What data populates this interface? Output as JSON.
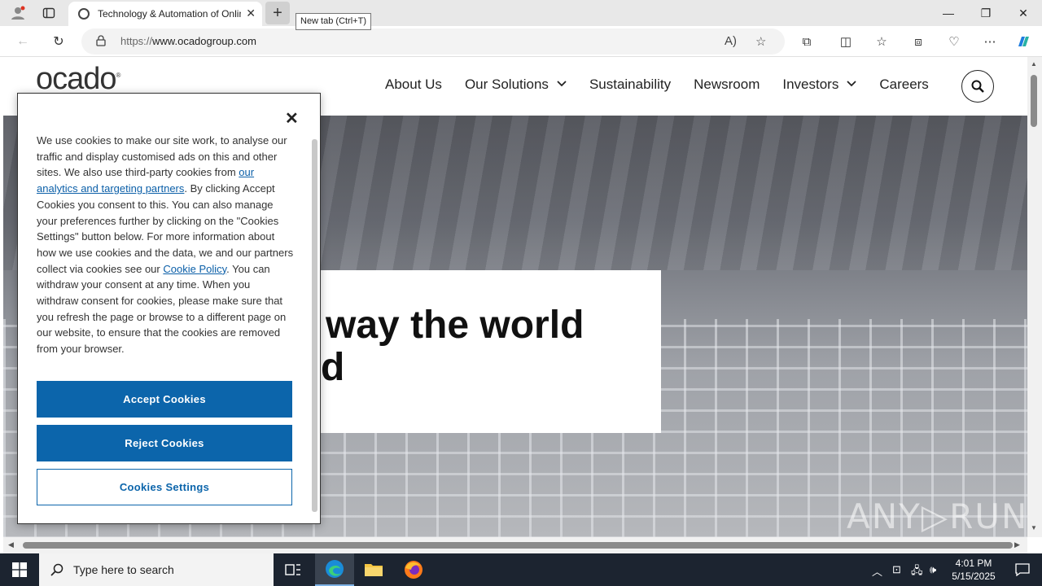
{
  "browser": {
    "tab_title": "Technology & Automation of Online Grocery Retail",
    "new_tab_tooltip": "New tab (Ctrl+T)",
    "url_prefix": "https://",
    "url_domain": "www.ocadogroup.com"
  },
  "site": {
    "logo": "ocado",
    "nav": {
      "about": "About Us",
      "solutions": "Our Solutions",
      "sustainability": "Sustainability",
      "newsroom": "Newsroom",
      "investors": "Investors",
      "careers": "Careers"
    },
    "hero_line1": "way the world",
    "hero_line2": "d",
    "watermark": "ANY▷RUN"
  },
  "cookie_banner": {
    "text_1": "We use cookies to make our site work, to analyse our traffic and display customised ads on this and other sites. We also use third-party cookies from ",
    "link_partners": "our analytics and targeting partners",
    "text_2": ". By clicking Accept Cookies you consent to this. You can also manage your preferences further by clicking on the \"Cookies Settings\" button below. For more information about how we use cookies and the data, we and our partners collect via cookies see our ",
    "link_policy": "Cookie Policy",
    "text_3": ". You can withdraw your consent at any time. When you withdraw consent for cookies, please make sure that you refresh the page or browse to a different page on our website, to ensure that the cookies are removed from your browser.",
    "accept_label": "Accept Cookies",
    "reject_label": "Reject Cookies",
    "settings_label": "Cookies Settings"
  },
  "taskbar": {
    "search_placeholder": "Type here to search",
    "time": "4:01 PM",
    "date": "5/15/2025"
  },
  "colors": {
    "cookie_button": "#0c65ab",
    "taskbar": "#1c2430"
  }
}
